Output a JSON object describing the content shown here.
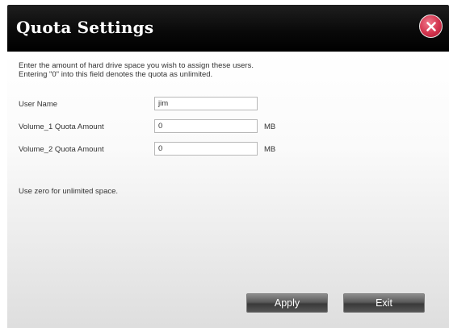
{
  "dialog": {
    "title": "Quota Settings",
    "close_icon": "close-icon",
    "close_color": "#d2334d"
  },
  "intro": {
    "line1": "Enter the amount of hard drive space you wish to assign these users.",
    "line2": "Entering \"0\" into this field denotes the quota as unlimited."
  },
  "form": {
    "user_name_label": "User Name",
    "user_name_value": "jim",
    "volume1_label": "Volume_1 Quota Amount",
    "volume1_value": "0",
    "volume1_unit": "MB",
    "volume2_label": "Volume_2 Quota Amount",
    "volume2_value": "0",
    "volume2_unit": "MB"
  },
  "hint": "Use zero for unlimited space.",
  "buttons": {
    "apply_label": "Apply",
    "exit_label": "Exit"
  }
}
